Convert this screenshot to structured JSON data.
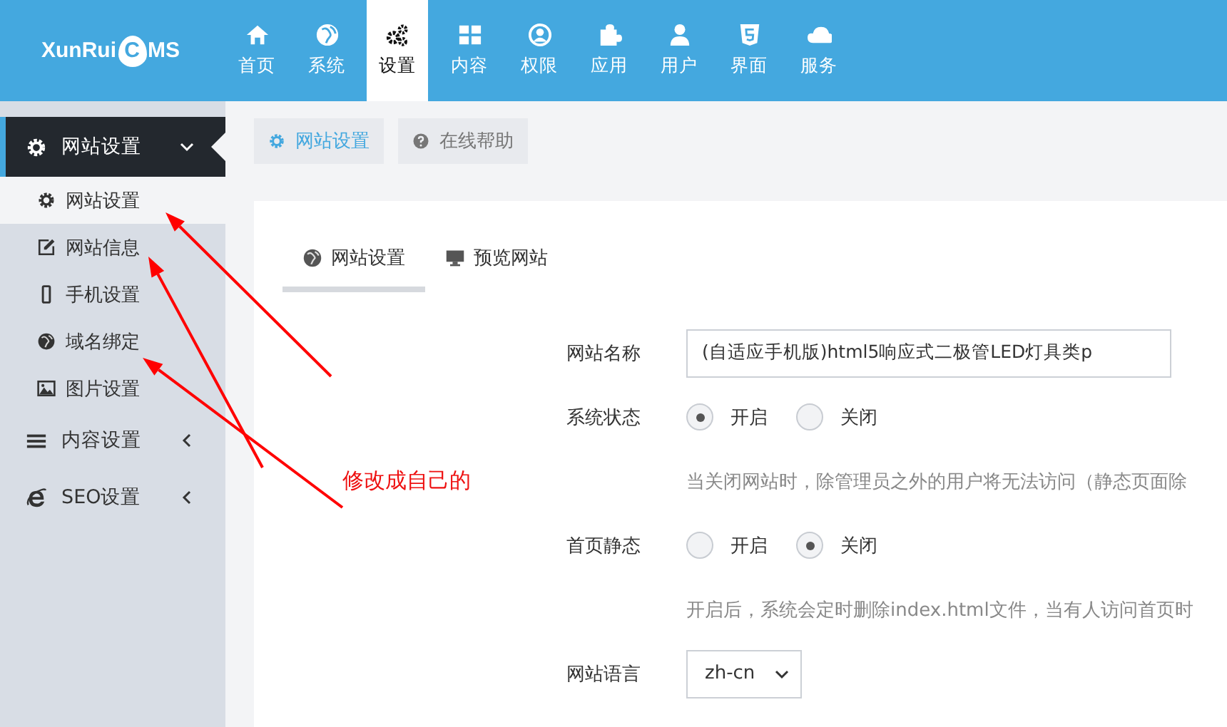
{
  "logo": {
    "before": "XunRui",
    "badge": "C",
    "after": "MS"
  },
  "nav": [
    {
      "label": "首页",
      "selected": false
    },
    {
      "label": "系统",
      "selected": false
    },
    {
      "label": "设置",
      "selected": true
    },
    {
      "label": "内容",
      "selected": false
    },
    {
      "label": "权限",
      "selected": false
    },
    {
      "label": "应用",
      "selected": false
    },
    {
      "label": "用户",
      "selected": false
    },
    {
      "label": "界面",
      "selected": false
    },
    {
      "label": "服务",
      "selected": false
    }
  ],
  "sidebar": [
    {
      "label": "网站设置",
      "expanded": true,
      "children": [
        {
          "label": "网站设置",
          "selected": true
        },
        {
          "label": "网站信息",
          "selected": false
        },
        {
          "label": "手机设置",
          "selected": false
        },
        {
          "label": "域名绑定",
          "selected": false
        },
        {
          "label": "图片设置",
          "selected": false
        }
      ]
    },
    {
      "label": "内容设置",
      "expanded": false
    },
    {
      "label": "SEO设置",
      "expanded": false
    }
  ],
  "breadcrumb": [
    {
      "label": "网站设置",
      "selected": true
    },
    {
      "label": "在线帮助",
      "selected": false
    }
  ],
  "tabs": [
    {
      "label": "网站设置",
      "selected": true
    },
    {
      "label": "预览网站",
      "selected": false
    }
  ],
  "form": [
    {
      "kind": "text",
      "label": "网站名称",
      "value": "(自适应手机版)html5响应式二极管LED灯具类p"
    },
    {
      "kind": "radio",
      "label": "系统状态",
      "options": [
        {
          "label": "开启",
          "selected": true
        },
        {
          "label": "关闭",
          "selected": false
        }
      ]
    },
    {
      "kind": "hint",
      "text": "当关闭网站时，除管理员之外的用户将无法访问（静态页面除"
    },
    {
      "kind": "radio",
      "label": "首页静态",
      "options": [
        {
          "label": "开启",
          "selected": false
        },
        {
          "label": "关闭",
          "selected": true
        }
      ]
    },
    {
      "kind": "hint",
      "text": "开启后，系统会定时删除index.html文件，当有人访问首页时"
    },
    {
      "kind": "select",
      "label": "网站语言",
      "value": "zh-cn"
    }
  ],
  "annotation": {
    "text": "修改成自己的"
  }
}
